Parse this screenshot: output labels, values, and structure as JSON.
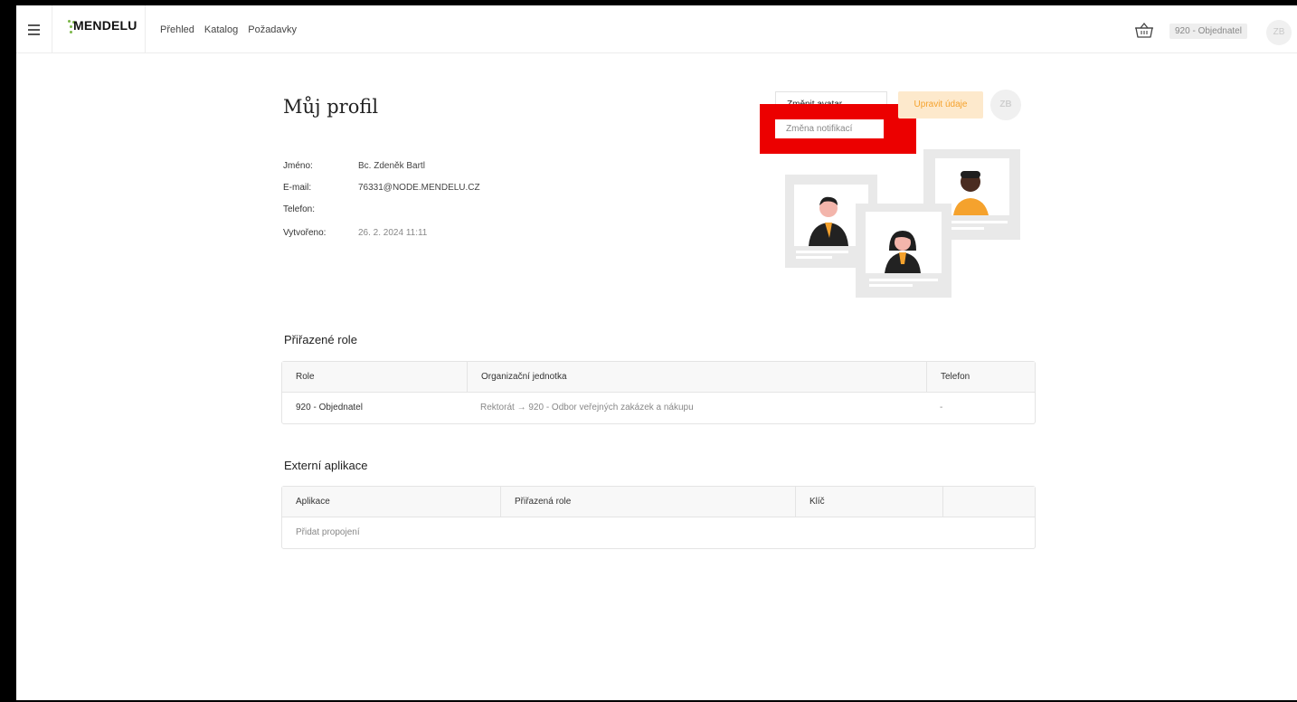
{
  "header": {
    "logo_text": "MENDELU",
    "nav": [
      "Přehled",
      "Katalog",
      "Požadavky"
    ],
    "role_badge": "920 - Objednatel",
    "avatar_initials": "ZB"
  },
  "profile": {
    "title": "Můj profil",
    "dropdown_toggle_label": "Změnit avatar",
    "dropdown_item_notifications": "Změna notifikací",
    "edit_button": "Upravit údaje",
    "avatar_initials": "ZB",
    "fields": [
      {
        "label": "Jméno:",
        "value": "Bc. Zdeněk Bartl"
      },
      {
        "label": "E-mail:",
        "value": "76331@NODE.MENDELU.CZ"
      },
      {
        "label": "Telefon:",
        "value": ""
      },
      {
        "label": "Vytvořeno:",
        "value": "26. 2. 2024 11:11"
      }
    ]
  },
  "roles": {
    "title": "Přiřazené role",
    "headers": [
      "Role",
      "Organizační jednotka",
      "Telefon"
    ],
    "rows": [
      [
        "920 - Objednatel",
        "Rektorát → 920 - Odbor veřejných zakázek a nákupu",
        "-"
      ]
    ]
  },
  "external": {
    "title": "Externí aplikace",
    "headers": [
      "Aplikace",
      "Přiřazená role",
      "Klíč",
      ""
    ],
    "add_link": "Přidat propojení"
  },
  "colors": {
    "accent": "#f5a22d",
    "accent_bg": "#fde9cc",
    "highlight": "#ec0000",
    "logo_green": "#7ab648"
  },
  "icons": {
    "menu": "hamburger-icon",
    "cart": "basket-icon"
  }
}
